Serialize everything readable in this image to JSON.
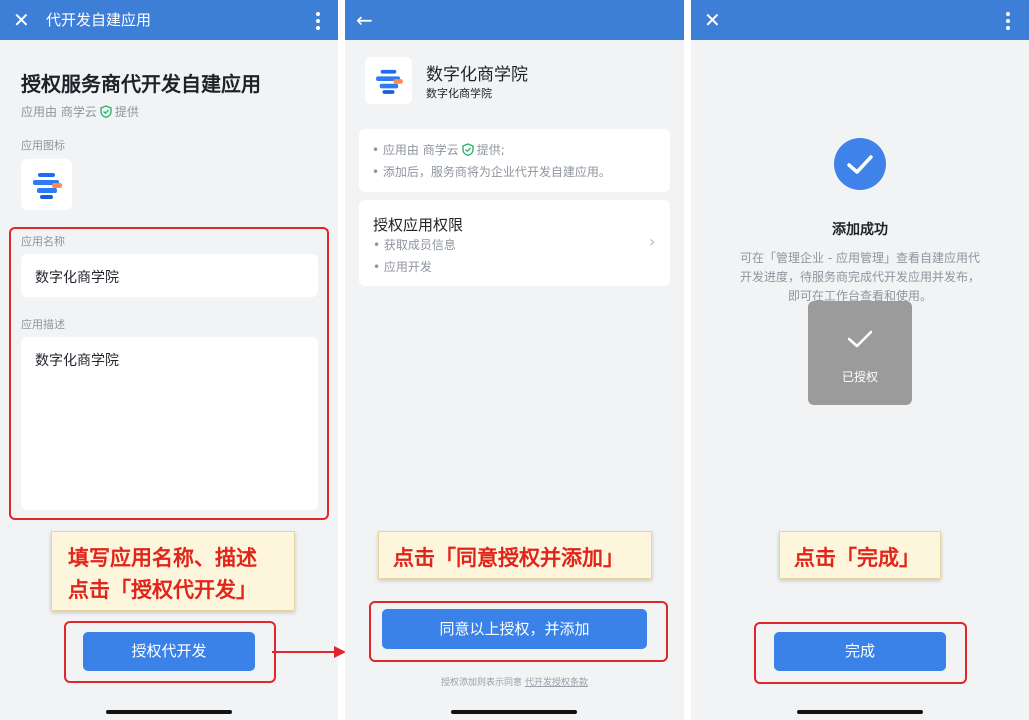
{
  "colors": {
    "topbar": "#3d7ed6",
    "button": "#3b82e8",
    "highlight": "#e0262b",
    "success": "#3f82ea",
    "callout_text": "#e1251b"
  },
  "panel1": {
    "topbar_title": "代开发自建应用",
    "heading": "授权服务商代开发自建应用",
    "provider_prefix": "应用由 商学云",
    "provider_suffix": "提供",
    "icon_label": "应用图标",
    "name_label": "应用名称",
    "name_value": "数字化商学院",
    "desc_label": "应用描述",
    "desc_value": "数字化商学院",
    "callout_line1": "填写应用名称、描述",
    "callout_line2": "点击「授权代开发」",
    "button_label": "授权代开发"
  },
  "panel2": {
    "app_name": "数字化商学院",
    "app_subtitle": "数字化商学院",
    "info_line1_prefix": "• 应用由 商学云",
    "info_line1_suffix": "提供;",
    "info_line2": "• 添加后，服务商将为企业代开发自建应用。",
    "permissions_title": "授权应用权限",
    "permission1": "• 获取成员信息",
    "permission2": "• 应用开发",
    "callout": "点击「同意授权并添加」",
    "button_label": "同意以上授权，并添加",
    "terms_prefix": "授权添加则表示同意",
    "terms_link": "代开发授权条款"
  },
  "panel3": {
    "success_title": "添加成功",
    "success_desc_line1": "可在「管理企业 - 应用管理」查看自建应用代",
    "success_desc_line2": "开发进度，待服务商完成代开发应用并发布，",
    "success_desc_line3": "即可在工作台查看和使用。",
    "toast_label": "已授权",
    "callout": "点击「完成」",
    "button_label": "完成"
  }
}
